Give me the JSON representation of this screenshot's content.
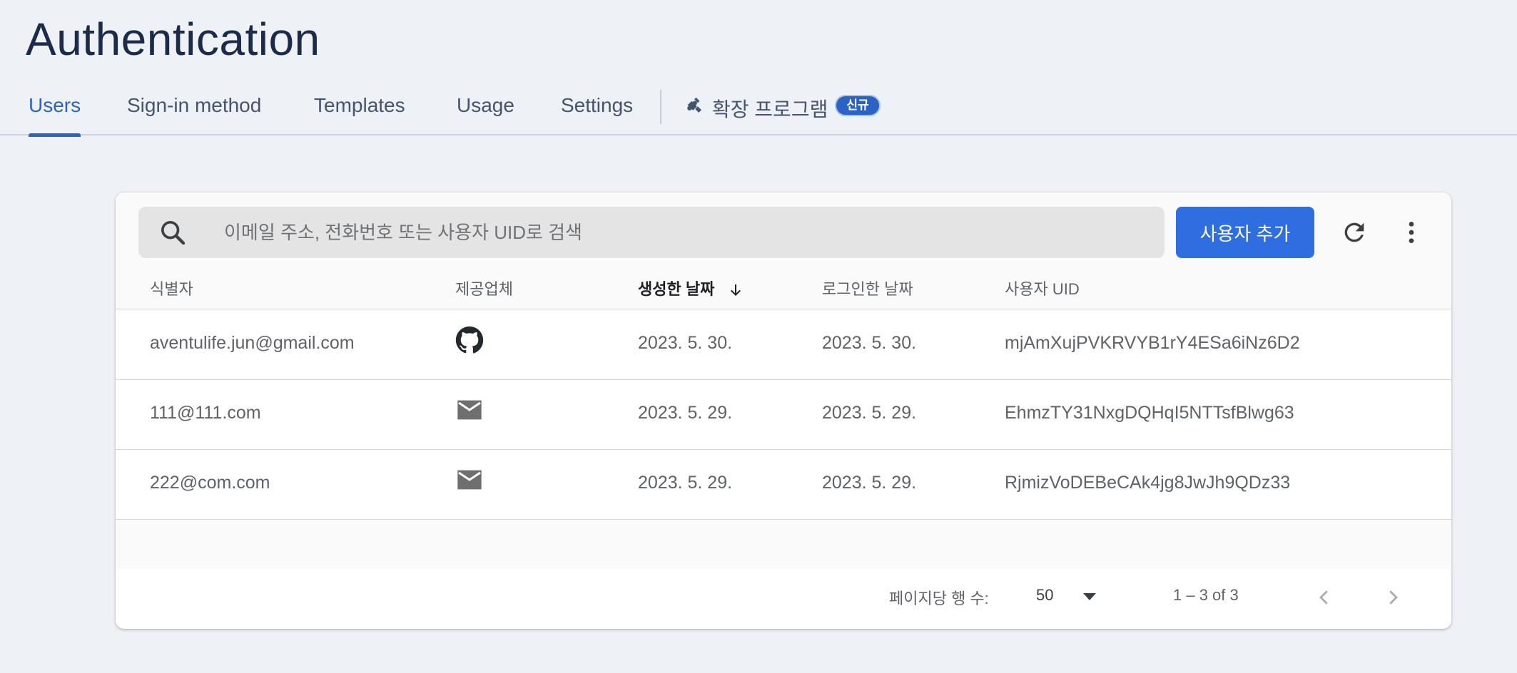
{
  "page": {
    "title": "Authentication"
  },
  "tabs": [
    {
      "label": "Users",
      "active": true
    },
    {
      "label": "Sign-in method"
    },
    {
      "label": "Templates"
    },
    {
      "label": "Usage"
    },
    {
      "label": "Settings"
    }
  ],
  "extension_tab": {
    "label": "확장 프로그램",
    "badge": "신규",
    "icon": "puzzle-icon"
  },
  "toolbar": {
    "search_placeholder": "이메일 주소, 전화번호 또는 사용자 UID로 검색",
    "add_user_label": "사용자 추가",
    "refresh_icon": "refresh-icon",
    "more_icon": "more-vert-icon"
  },
  "table": {
    "columns": {
      "identifier": "식별자",
      "provider": "제공업체",
      "created": "생성한 날짜",
      "signed_in": "로그인한 날짜",
      "uid": "사용자 UID"
    },
    "sorted_column": "created",
    "sort_direction": "descending",
    "rows": [
      {
        "identifier": "aventulife.jun@gmail.com",
        "provider": "github-icon",
        "created": "2023. 5. 30.",
        "signed_in": "2023. 5. 30.",
        "uid": "mjAmXujPVKRVYB1rY4ESa6iNz6D2"
      },
      {
        "identifier": "111@111.com",
        "provider": "email-icon",
        "created": "2023. 5. 29.",
        "signed_in": "2023. 5. 29.",
        "uid": "EhmzTY31NxgDQHqI5NTTsfBlwg63"
      },
      {
        "identifier": "222@com.com",
        "provider": "email-icon",
        "created": "2023. 5. 29.",
        "signed_in": "2023. 5. 29.",
        "uid": "RjmizVoDEBeCAk4jg8JwJh9QDz33"
      }
    ]
  },
  "pagination": {
    "rows_per_page_label": "페이지당 행 수:",
    "rows_per_page": "50",
    "range": "1 – 3 of 3"
  },
  "colors": {
    "accent": "#2b63c5",
    "button": "#2f6ee0",
    "background": "#eef1f5",
    "title": "#1c2b4a"
  }
}
